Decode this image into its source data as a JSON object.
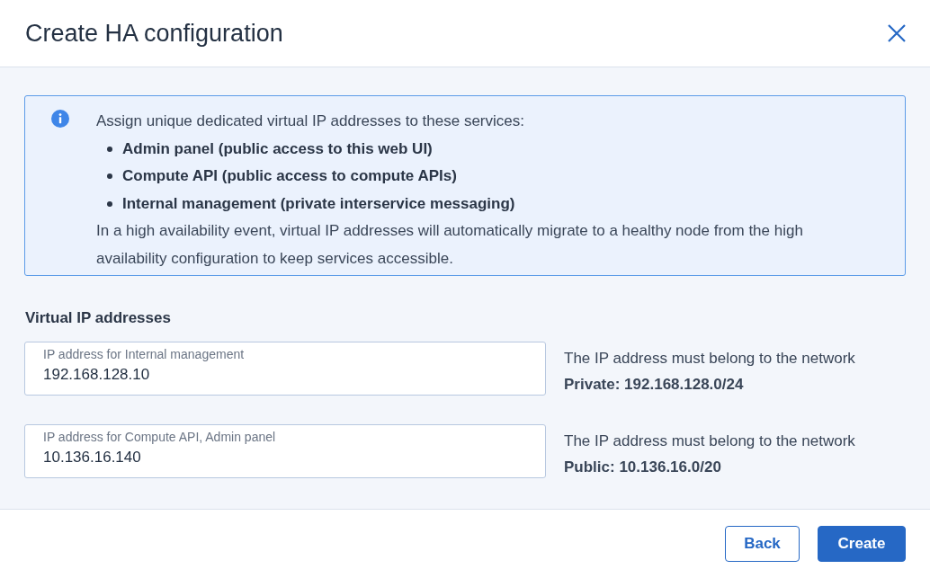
{
  "dialog": {
    "title": "Create HA configuration"
  },
  "info": {
    "intro": "Assign unique dedicated virtual IP addresses to these services:",
    "services": [
      "Admin panel (public access to this web UI)",
      "Compute API (public access to compute APIs)",
      "Internal management (private interservice messaging)"
    ],
    "note": "In a high availability event, virtual IP addresses will automatically migrate to a healthy node from the high availability configuration to keep services accessible."
  },
  "section_title": "Virtual IP addresses",
  "fields": [
    {
      "label": "IP address for Internal management",
      "value": "192.168.128.10",
      "hint": "The IP address must belong to the network",
      "network": "Private: 192.168.128.0/24"
    },
    {
      "label": "IP address for Compute API, Admin panel",
      "value": "10.136.16.140",
      "hint": "The IP address must belong to the network",
      "network": "Public: 10.136.16.0/20"
    }
  ],
  "buttons": [
    {
      "label": "Back",
      "kind": "secondary"
    },
    {
      "label": "Create",
      "kind": "primary"
    }
  ]
}
